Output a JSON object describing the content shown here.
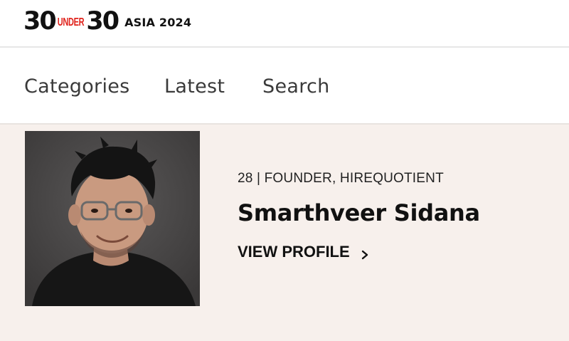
{
  "header": {
    "logo": {
      "thirty_a": "30",
      "under": "UNDER",
      "thirty_b": "30",
      "edition": "ASIA 2024"
    }
  },
  "nav": {
    "items": [
      {
        "label": "Categories"
      },
      {
        "label": "Latest"
      },
      {
        "label": "Search"
      }
    ]
  },
  "profile": {
    "meta": "28 | FOUNDER, HIREQUOTIENT",
    "name": "Smarthveer Sidana",
    "view_label": "VIEW PROFILE",
    "view_icon": "chevron-right-icon"
  },
  "colors": {
    "accent_red": "#e0221b",
    "main_bg": "#f7f0ec"
  }
}
